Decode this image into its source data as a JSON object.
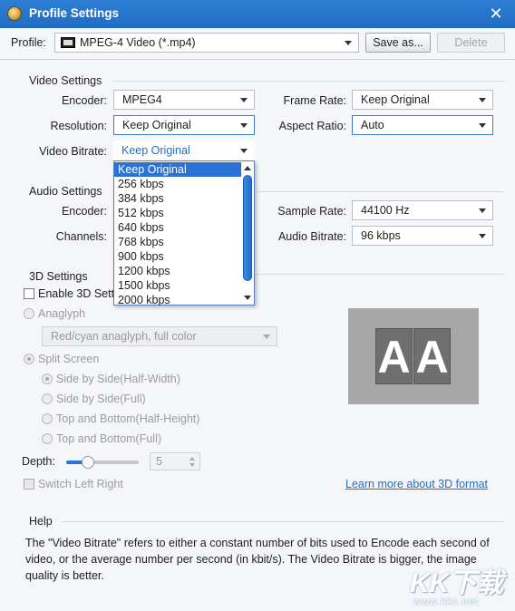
{
  "window": {
    "title": "Profile Settings",
    "close_icon": "close-icon",
    "app_icon": "app-logo-icon"
  },
  "profile": {
    "label": "Profile:",
    "value": "MPEG-4 Video (*.mp4)",
    "icon": "mpeg4-video-icon",
    "save_as": "Save as...",
    "delete": "Delete"
  },
  "video": {
    "heading": "Video Settings",
    "encoder_label": "Encoder:",
    "encoder": "MPEG4",
    "frame_rate_label": "Frame Rate:",
    "frame_rate": "Keep Original",
    "resolution_label": "Resolution:",
    "resolution": "Keep Original",
    "aspect_label": "Aspect Ratio:",
    "aspect": "Auto",
    "bitrate_label": "Video Bitrate:",
    "bitrate": "Keep Original",
    "bitrate_options": [
      "Keep Original",
      "256 kbps",
      "384 kbps",
      "512 kbps",
      "640 kbps",
      "768 kbps",
      "900 kbps",
      "1200 kbps",
      "1500 kbps",
      "2000 kbps"
    ]
  },
  "audio": {
    "heading": "Audio Settings",
    "encoder_label": "Encoder:",
    "channels_label": "Channels:",
    "sample_rate_label": "Sample Rate:",
    "sample_rate": "44100 Hz",
    "bitrate_label": "Audio Bitrate:",
    "bitrate": "96 kbps"
  },
  "three_d": {
    "heading": "3D Settings",
    "enable_label": "Enable 3D Setti",
    "anaglyph_label": "Anaglyph",
    "anaglyph_mode": "Red/cyan anaglyph, full color",
    "split_label": "Split Screen",
    "options": [
      "Side by Side(Half-Width)",
      "Side by Side(Full)",
      "Top and Bottom(Half-Height)",
      "Top and Bottom(Full)"
    ],
    "depth_label": "Depth:",
    "depth_value": "5",
    "depth_slider_fraction": 0.3,
    "switch_label": "Switch Left Right",
    "learn_more": "Learn more about 3D format",
    "preview_letters": [
      "A",
      "A"
    ]
  },
  "help": {
    "heading": "Help",
    "text": "The \"Video Bitrate\" refers to either a constant number of bits used to Encode each second of video, or the average number per second (in kbit/s). The Video Bitrate is bigger, the image quality is better."
  },
  "watermark": {
    "mark": "KK下载",
    "url": "www.kkx.net"
  }
}
